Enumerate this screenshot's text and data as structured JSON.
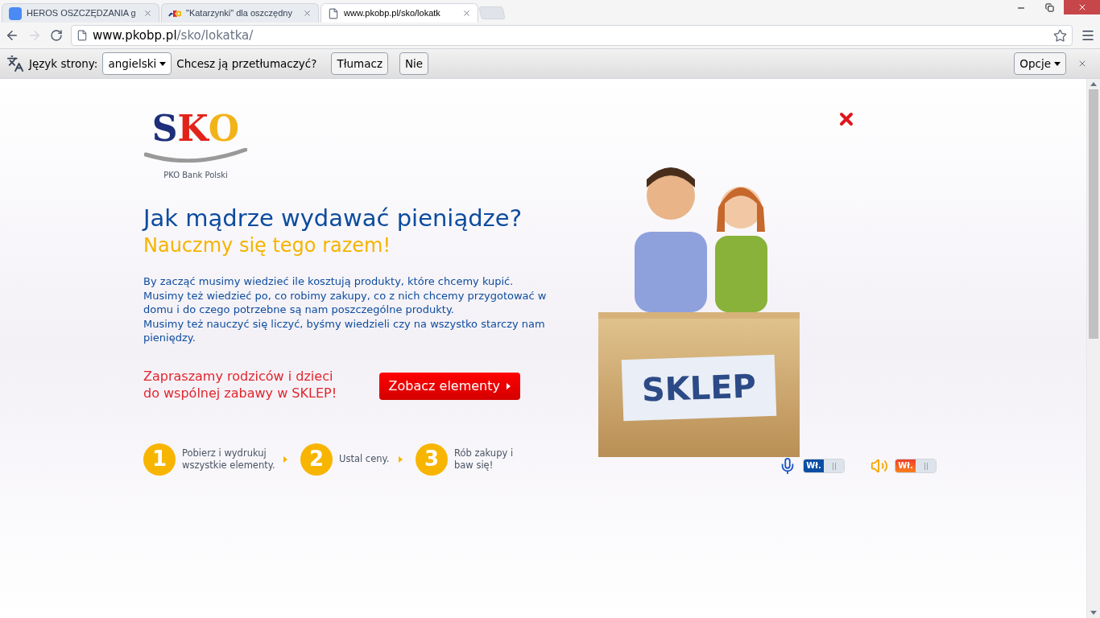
{
  "browser": {
    "tabs": [
      {
        "title": "HEROS OSZCZĘDZANIA g",
        "selected": false
      },
      {
        "title": "\"Katarzynki\" dla oszczędny",
        "selected": false
      },
      {
        "title": "www.pkobp.pl/sko/lokatk",
        "selected": true
      }
    ],
    "address": {
      "domain": "www.pkobp.pl",
      "path": "/sko/lokatka/"
    },
    "translate_bar": {
      "language_label": "Język strony:",
      "language": "angielski",
      "question": "Chcesz ją przetłumaczyć?",
      "buttons": [
        "Tłumacz",
        "Nie"
      ],
      "options": "Opcje"
    }
  },
  "page": {
    "logo": {
      "letters": [
        "S",
        "K",
        "O"
      ],
      "bank": "PKO Bank Polski"
    },
    "title": "Jak mądrze wydawać pieniądze?",
    "subtitle": "Nauczmy się tego razem!",
    "paragraphs": [
      "By zacząć musimy wiedzieć ile kosztują produkty, które chcemy kupić.",
      "Musimy też wiedzieć po, co robimy zakupy, co z nich chcemy przygotować w domu i do czego potrzebne są nam poszczególne produkty.",
      "Musimy też nauczyć się liczyć, byśmy wiedzieli czy na wszystko starczy nam pieniędzy."
    ],
    "invite": "Zapraszamy rodziców i dzieci do wspólnej zabawy w SKLEP!",
    "cta": "Zobacz elementy",
    "steps": [
      {
        "number": "1",
        "text": "Pobierz i wydrukuj wszystkie elementy."
      },
      {
        "number": "2",
        "text": "Ustal ceny."
      },
      {
        "number": "3",
        "text": "Rób zakupy i baw się!"
      }
    ],
    "sign": "SKLEP",
    "toggles": [
      {
        "kind": "microphone",
        "label": "Wł.",
        "on": true
      },
      {
        "kind": "speaker",
        "label": "Wł.",
        "on": true
      }
    ]
  }
}
